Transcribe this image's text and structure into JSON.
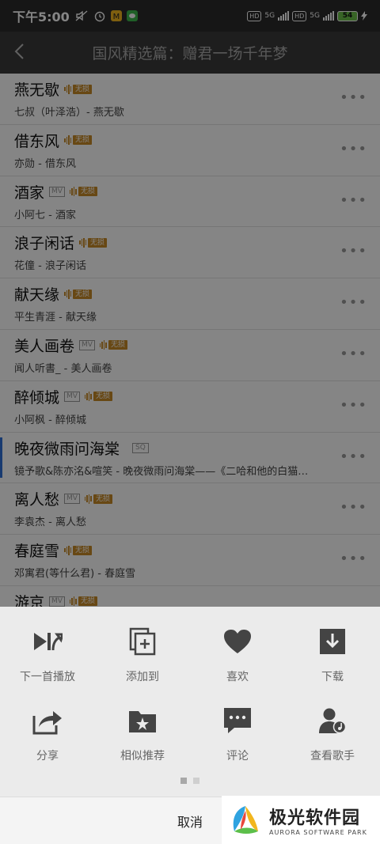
{
  "status_bar": {
    "time": "下午5:00",
    "battery": "54",
    "hd1": "HD",
    "net1": "5G",
    "hd2": "HD",
    "net2": "5G"
  },
  "header": {
    "title": "国风精选篇：赠君一场千年梦"
  },
  "tags": {
    "lossless": "无损",
    "mv": "MV",
    "sq": "SQ"
  },
  "songs": [
    {
      "name": "燕无歇",
      "sub": "七叔（叶泽浩）- 燕无歇"
    },
    {
      "name": "借东风",
      "sub": "亦勋 - 借东风"
    },
    {
      "name": "酒家",
      "sub": "小阿七 - 酒家"
    },
    {
      "name": "浪子闲话",
      "sub": "花僮 - 浪子闲话"
    },
    {
      "name": "献天缘",
      "sub": "平生青涯 - 献天缘"
    },
    {
      "name": "美人画卷",
      "sub": "闻人听書_ - 美人画卷"
    },
    {
      "name": "醉倾城",
      "sub": "小阿枫 - 醉倾城"
    },
    {
      "name": "晚夜微雨问海棠",
      "sub": "镜予歌&陈亦洺&喧笑 - 晚夜微雨问海棠——《二哈和他的白猫…"
    },
    {
      "name": "离人愁",
      "sub": "李袁杰 - 离人愁"
    },
    {
      "name": "春庭雪",
      "sub": "邓寓君(等什么君) - 春庭雪"
    },
    {
      "name": "游京",
      "sub": ""
    }
  ],
  "actions": {
    "play_next": "下一首播放",
    "add_to": "添加到",
    "like": "喜欢",
    "download": "下载",
    "share": "分享",
    "similar": "相似推荐",
    "comment": "评论",
    "view_singer": "查看歌手"
  },
  "cancel": "取消",
  "watermark": {
    "title": "极光软件园",
    "subtitle": "AURORA SOFTWARE PARK"
  },
  "colors": {
    "lossless_tag": "#c88a28",
    "active_indicator": "#2f6fd6",
    "sheet_bg": "#ebebeb",
    "icon": "#444444"
  }
}
